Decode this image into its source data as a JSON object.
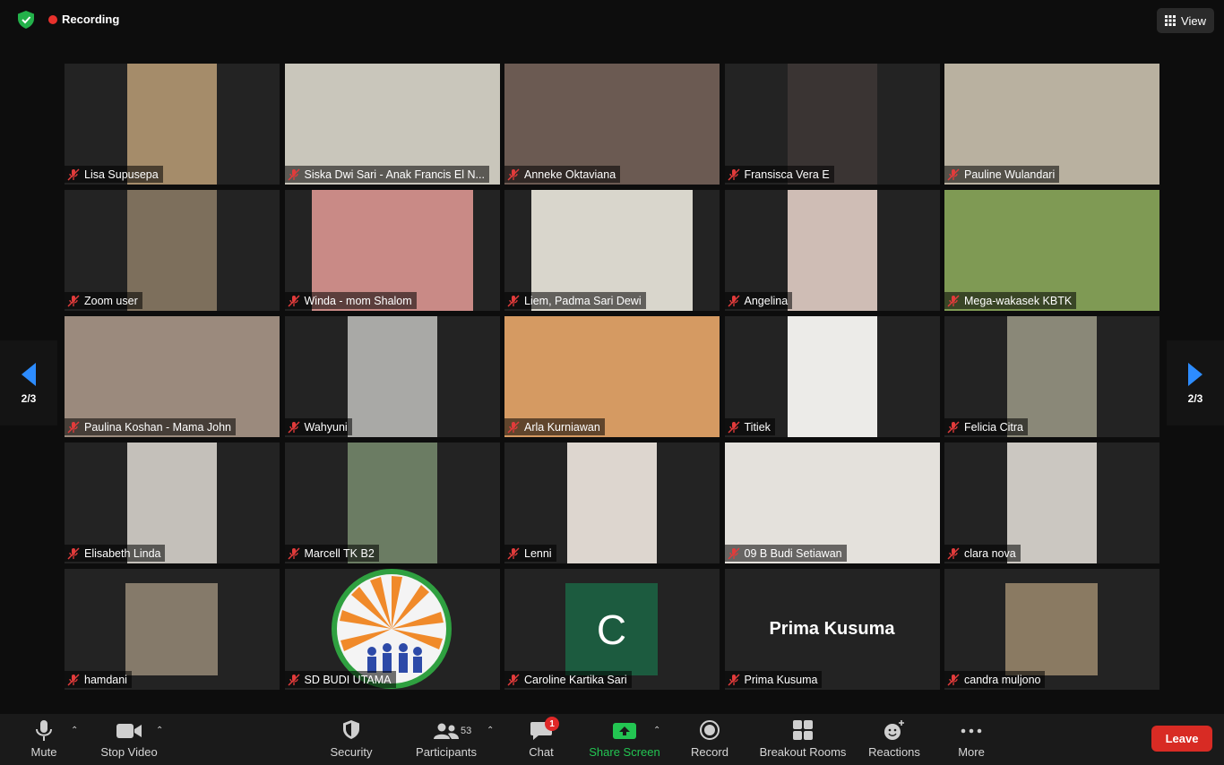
{
  "header": {
    "recording_label": "Recording",
    "view_label": "View"
  },
  "pager": {
    "left_label": "2/3",
    "right_label": "2/3"
  },
  "participants": [
    {
      "name": "Lisa Supusepa",
      "video": "#a58c6a"
    },
    {
      "name": "Siska Dwi Sari - Anak Francis El N...",
      "video": "#c9c6bb"
    },
    {
      "name": "Anneke Oktaviana",
      "video": "#6b5a52"
    },
    {
      "name": "Fransisca Vera E",
      "video": "#3a3433"
    },
    {
      "name": "Pauline Wulandari",
      "video": "#b9b1a0"
    },
    {
      "name": "Zoom user",
      "video": "#7d6f5c"
    },
    {
      "name": "Winda - mom Shalom",
      "video": "#c98a86"
    },
    {
      "name": "Liem, Padma Sari Dewi",
      "video": "#d9d6cc"
    },
    {
      "name": "Angelina",
      "video": "#cfbdb5"
    },
    {
      "name": "Mega-wakasek KBTK",
      "video": "#7f9a54"
    },
    {
      "name": "Paulina Koshan - Mama John",
      "video": "#9b8a7d"
    },
    {
      "name": "Wahyuni",
      "video": "#a9a9a6"
    },
    {
      "name": "Arla Kurniawan",
      "video": "#d59a62"
    },
    {
      "name": "Titiek",
      "video": "#ecebe8"
    },
    {
      "name": "Felicia Citra",
      "video": "#8a8878"
    },
    {
      "name": "Elisabeth Linda",
      "video": "#c4c0ba"
    },
    {
      "name": "Marcell TK B2",
      "video": "#6b7c63"
    },
    {
      "name": "Lenni",
      "video": "#ddd6cf"
    },
    {
      "name": "09 B Budi Setiawan",
      "video": "#e4e1dc"
    },
    {
      "name": "clara nova",
      "video": "#cbc7c1"
    },
    {
      "name": "hamdani",
      "video": "#857a6a"
    },
    {
      "name": "SD BUDI UTAMA",
      "video": "#f4f4f4"
    },
    {
      "name": "Caroline Kartika Sari",
      "avatar_letter": "C",
      "video": "#1c5b3f"
    },
    {
      "name": "Prima Kusuma",
      "display_name": "Prima Kusuma"
    },
    {
      "name": "candra muljono",
      "video": "#8a7a62"
    }
  ],
  "toolbar": {
    "mute_label": "Mute",
    "stop_video_label": "Stop Video",
    "security_label": "Security",
    "participants_label": "Participants",
    "participants_count": "53",
    "chat_label": "Chat",
    "chat_badge": "1",
    "share_screen_label": "Share Screen",
    "record_label": "Record",
    "breakout_label": "Breakout Rooms",
    "reactions_label": "Reactions",
    "more_label": "More",
    "leave_label": "Leave"
  }
}
